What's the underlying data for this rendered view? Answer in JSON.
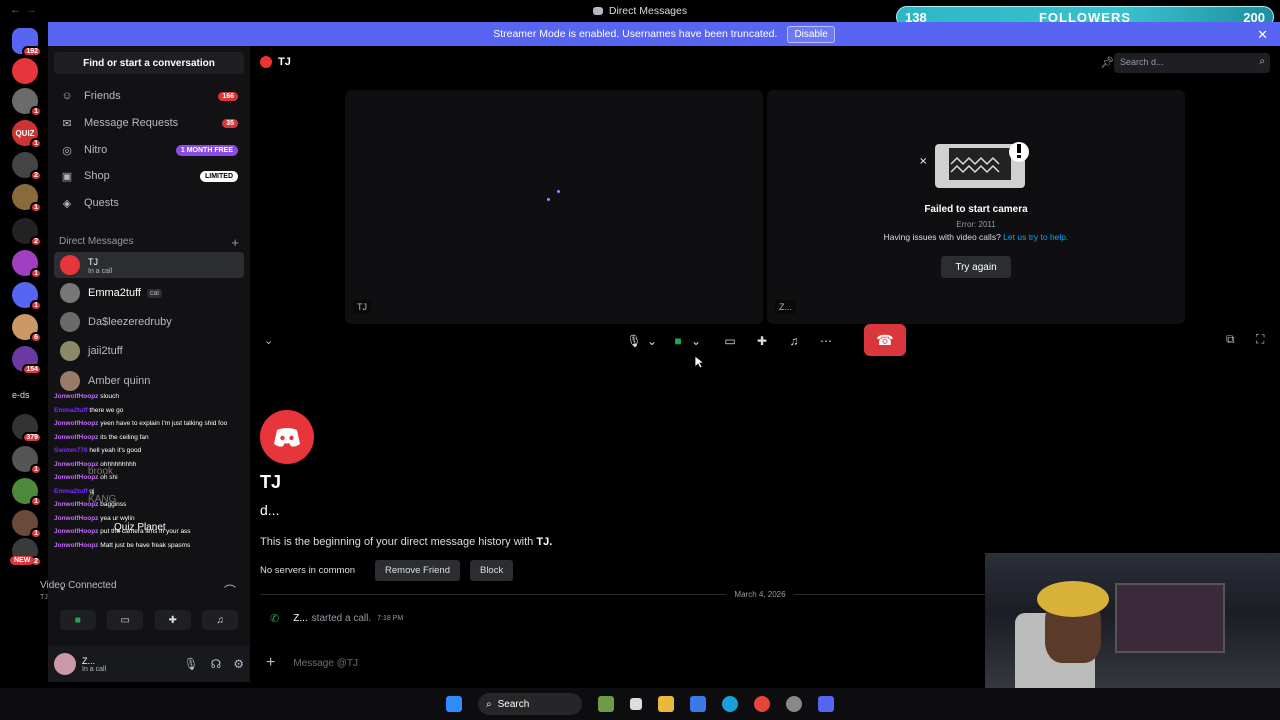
{
  "window": {
    "title": "Direct Messages"
  },
  "stream_overlay": {
    "followers_current": "138",
    "followers_label": "FOLLOWERS",
    "followers_goal": "200"
  },
  "banner": {
    "text": "Streamer Mode is enabled. Usernames have been truncated.",
    "disable_label": "Disable"
  },
  "server_rail": {
    "badges": [
      "192",
      "1",
      "1",
      "2",
      "1",
      "2",
      "1",
      "1",
      "2",
      "1",
      "6",
      "154",
      "379",
      "1",
      "1",
      "1",
      "2"
    ],
    "texts": [
      "QUIZ",
      "e-ds",
      "NEW"
    ]
  },
  "sidebar": {
    "find_conversation": "Find or start a conversation",
    "nav": [
      {
        "label": "Friends",
        "count": "166",
        "icon": "friends-icon"
      },
      {
        "label": "Message Requests",
        "count": "35",
        "icon": "mail-icon"
      },
      {
        "label": "Nitro",
        "pill": "1 MONTH FREE",
        "icon": "nitro-icon"
      },
      {
        "label": "Shop",
        "pill": "LIMITED",
        "icon": "shop-icon"
      },
      {
        "label": "Quests",
        "icon": "quests-icon"
      }
    ],
    "dm_header": "Direct Messages",
    "dms": [
      {
        "name": "TJ",
        "sub": "In a call"
      },
      {
        "name": "Emma2tuff",
        "tag": "cai"
      },
      {
        "name": "Da$leezeredruby"
      },
      {
        "name": "jaii2tuff"
      },
      {
        "name": "Amber quinn"
      }
    ],
    "partial_dms": [
      "brook",
      "KANG",
      "Quiz Planet"
    ],
    "voice": {
      "status": "Video Connected",
      "channel": "TJ"
    },
    "user": {
      "name": "Z...",
      "status": "In a call"
    }
  },
  "chat_overlay": [
    {
      "user": "JonwolfHoopz",
      "msg": "slouch"
    },
    {
      "user": "Emma2tuff",
      "msg": "there we go"
    },
    {
      "user": "JonwolfHoopz",
      "msg": "yeen have to explain I'm just talking shid foo"
    },
    {
      "user": "JonwolfHoopz",
      "msg": "its the ceiling fan"
    },
    {
      "user": "Swimm776",
      "msg": "hell yeah it's good"
    },
    {
      "user": "JonwolfHoopz",
      "msg": "ohhhhhhhhh"
    },
    {
      "user": "JonwolfHoopz",
      "msg": "oh shi"
    },
    {
      "user": "Emma2tuff",
      "msg": "gj"
    },
    {
      "user": "JonwolfHoopz",
      "msg": "bagginss"
    },
    {
      "user": "JonwolfHoopz",
      "msg": "yea ur wylin"
    },
    {
      "user": "JonwolfHoopz",
      "msg": "put the camera lens in your ass"
    },
    {
      "user": "JonwolfHoopz",
      "msg": "Matt just be have freak spasms"
    }
  ],
  "call": {
    "header_name": "TJ",
    "search_placeholder": "Search d...",
    "tile_left_name": "TJ",
    "tile_right_name": "Z...",
    "camera_error_title": "Failed to start camera",
    "camera_error_code": "Error: 2011",
    "camera_help": "Having issues with video calls?",
    "camera_help_link": "Let us try to help.",
    "try_again": "Try again"
  },
  "dm": {
    "name": "TJ",
    "username": "d...",
    "beginning_prefix": "This is the beginning of your direct message history with ",
    "beginning_name": "TJ.",
    "no_servers": "No servers in common",
    "remove_friend": "Remove Friend",
    "block": "Block",
    "date": "March 4, 2026",
    "call_user": "Z...",
    "call_text": "started a call.",
    "call_time": "7:18 PM",
    "input_placeholder": "Message @TJ"
  },
  "taskbar": {
    "search_label": "Search"
  },
  "colors": {
    "accent": "#5865f2",
    "danger": "#da373c",
    "green": "#23a55a"
  }
}
